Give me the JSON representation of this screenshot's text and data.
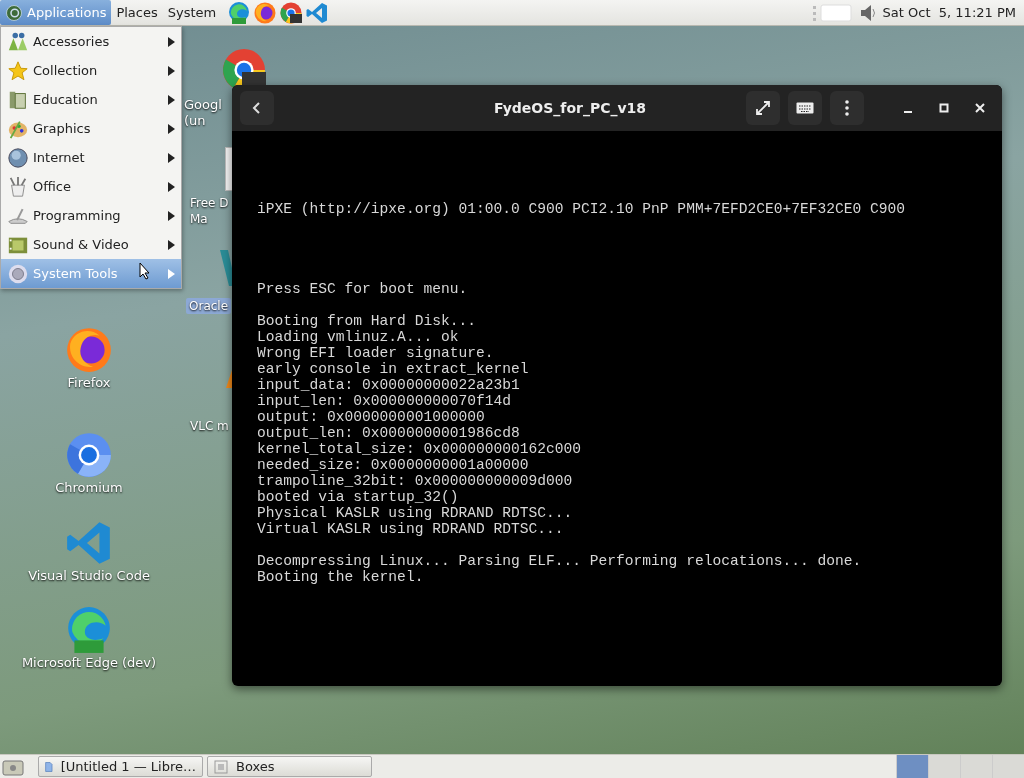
{
  "top_panel": {
    "menus": [
      {
        "label": "Applications",
        "selected": true
      },
      {
        "label": "Places",
        "selected": false
      },
      {
        "label": "System",
        "selected": false
      }
    ],
    "launchers": [
      {
        "kind": "edge-dev"
      },
      {
        "kind": "firefox"
      },
      {
        "kind": "chrome-dev"
      },
      {
        "kind": "vscode"
      }
    ],
    "clock": "Sat Oct  5, 11:21 PM"
  },
  "applications_menu": [
    {
      "label": "Accessories",
      "kind": "accessories",
      "selected": false
    },
    {
      "label": "Collection",
      "kind": "star",
      "selected": false
    },
    {
      "label": "Education",
      "kind": "education",
      "selected": false
    },
    {
      "label": "Graphics",
      "kind": "graphics",
      "selected": false
    },
    {
      "label": "Internet",
      "kind": "globe",
      "selected": false
    },
    {
      "label": "Office",
      "kind": "office",
      "selected": false
    },
    {
      "label": "Programming",
      "kind": "programming",
      "selected": false
    },
    {
      "label": "Sound & Video",
      "kind": "film",
      "selected": false
    },
    {
      "label": "System Tools",
      "kind": "gear",
      "selected": true
    }
  ],
  "desktop_icons": [
    {
      "kind": "chrome-dev",
      "lines": [
        "Googl",
        "(un"
      ],
      "selected": false
    },
    {
      "kind": "file",
      "lines": [
        "Free D",
        "Ma"
      ],
      "selected": false
    },
    {
      "kind": "oracle",
      "lines": [
        "Oracle"
      ],
      "selected": true
    },
    {
      "kind": "vlc",
      "lines": [
        "VLC m"
      ],
      "selected": false
    },
    {
      "kind": "firefox",
      "lines": [
        "Firefox"
      ],
      "selected": false
    },
    {
      "kind": "chromium",
      "lines": [
        "Chromium"
      ],
      "selected": false
    },
    {
      "kind": "vscode",
      "lines": [
        "Visual Studio Code"
      ],
      "selected": false
    },
    {
      "kind": "edge-dev",
      "lines": [
        "Microsoft Edge (dev)"
      ],
      "selected": false
    }
  ],
  "window": {
    "title": "FydeOS_for_PC_v18",
    "console_blocks": [
      [
        "iPXE (http://ipxe.org) 01:00.0 C900 PCI2.10 PnP PMM+7EFD2CE0+7EF32CE0 C900"
      ],
      [
        "Press ESC for boot menu."
      ],
      [
        "Booting from Hard Disk...",
        "Loading vmlinuz.A... ok",
        "Wrong EFI loader signature.",
        "early console in extract_kernel",
        "input_data: 0x00000000022a23b1",
        "input_len: 0x000000000070f14d",
        "output: 0x0000000001000000",
        "output_len: 0x0000000001986cd8",
        "kernel_total_size: 0x000000000162c000",
        "needed_size: 0x0000000001a00000",
        "trampoline_32bit: 0x000000000009d000",
        "booted via startup_32()",
        "Physical KASLR using RDRAND RDTSC...",
        "Virtual KASLR using RDRAND RDTSC..."
      ],
      [
        "Decompressing Linux... Parsing ELF... Performing relocations... done.",
        "Booting the kernel."
      ]
    ]
  },
  "taskbar": {
    "windows": [
      {
        "label": "[Untitled 1 — Libre…",
        "kind": "document"
      },
      {
        "label": "Boxes",
        "kind": "boxes"
      }
    ],
    "workspaces": [
      {
        "selected": true
      },
      {
        "selected": false
      },
      {
        "selected": false
      },
      {
        "selected": false
      }
    ]
  }
}
